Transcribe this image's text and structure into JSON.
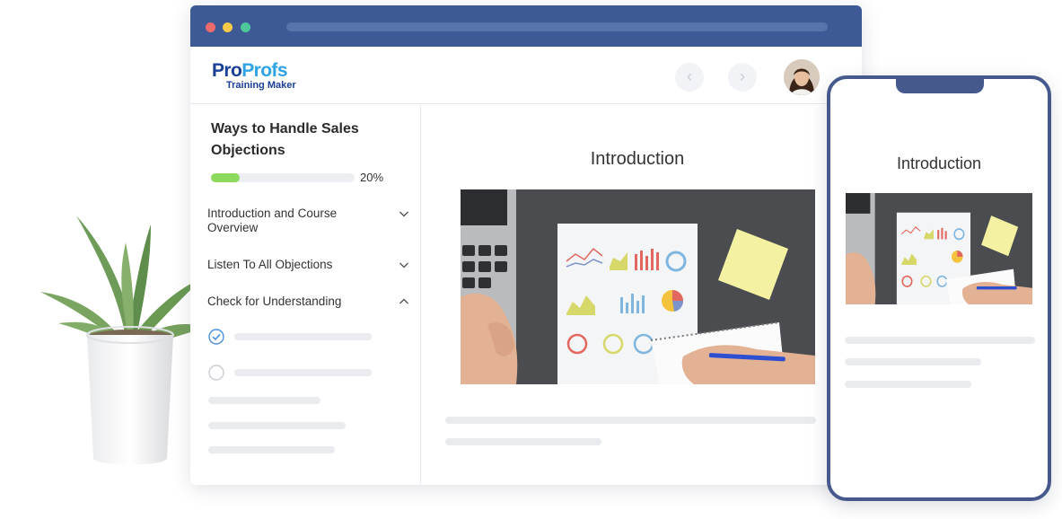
{
  "brand": {
    "name_part1": "Pro",
    "name_part2": "Profs",
    "product": "Training Maker"
  },
  "course": {
    "title": "Ways to Handle Sales Objections",
    "progress_percent": 20,
    "progress_label": "20%",
    "sections": [
      {
        "label": "Introduction and Course Overview",
        "expanded": false,
        "chevron": "chevron-down-icon"
      },
      {
        "label": "Listen To All Objections",
        "expanded": false,
        "chevron": "chevron-down-icon"
      },
      {
        "label": "Check for Understanding",
        "expanded": true,
        "chevron": "chevron-up-icon"
      }
    ],
    "lessons": [
      {
        "completed": true
      },
      {
        "completed": false
      }
    ]
  },
  "content": {
    "title": "Introduction"
  },
  "mobile": {
    "title": "Introduction"
  },
  "colors": {
    "titlebar": "#3d5a96",
    "brand_blue": "#1a3f95",
    "brand_accent": "#2fa3e6",
    "progress": "#8bd95d",
    "phone_frame": "#45598c",
    "check": "#4a90d9"
  }
}
